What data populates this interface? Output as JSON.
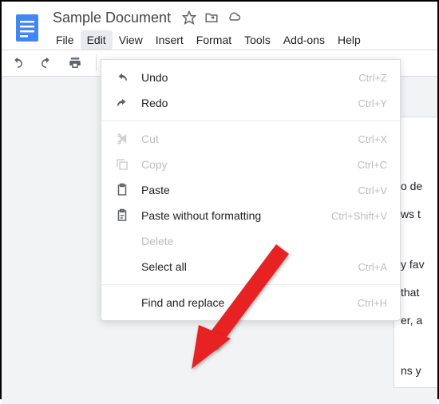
{
  "doc": {
    "title": "Sample Document"
  },
  "menu": {
    "file": "File",
    "edit": "Edit",
    "view": "View",
    "insert": "Insert",
    "format": "Format",
    "tools": "Tools",
    "addons": "Add-ons",
    "help": "Help"
  },
  "dropdown": {
    "undo": {
      "label": "Undo",
      "shortcut": "Ctrl+Z"
    },
    "redo": {
      "label": "Redo",
      "shortcut": "Ctrl+Y"
    },
    "cut": {
      "label": "Cut",
      "shortcut": "Ctrl+X"
    },
    "copy": {
      "label": "Copy",
      "shortcut": "Ctrl+C"
    },
    "paste": {
      "label": "Paste",
      "shortcut": "Ctrl+V"
    },
    "pasteNoFmt": {
      "label": "Paste without formatting",
      "shortcut": "Ctrl+Shift+V"
    },
    "delete": {
      "label": "Delete"
    },
    "selectAll": {
      "label": "Select all",
      "shortcut": "Ctrl+A"
    },
    "findReplace": {
      "label": "Find and replace",
      "shortcut": "Ctrl+H"
    }
  },
  "docBody": {
    "line1": "o de",
    "line2": "ws t",
    "line3": "y fav",
    "line4": " that",
    "line5": "er, a",
    "line6": "ns y"
  }
}
